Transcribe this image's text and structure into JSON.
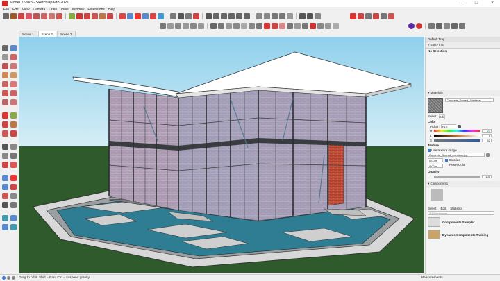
{
  "window": {
    "title": "Model 26.skp - SketchUp Pro 2021"
  },
  "menu": [
    "File",
    "Edit",
    "View",
    "Camera",
    "Draw",
    "Tools",
    "Window",
    "Extensions",
    "Help"
  ],
  "scenes": [
    "Scene 1",
    "Scene 2",
    "Scene 3"
  ],
  "tray": {
    "title": "Default Tray",
    "entity_info": {
      "header": "Entity Info",
      "value": "No Selection"
    },
    "materials": {
      "header": "Materials",
      "name": "Concrete_Scored_Jointless",
      "tabs": [
        "Select",
        "Edit"
      ],
      "color_label": "Color",
      "picker_label": "Picker:",
      "picker_value": "HLS",
      "sliders": [
        {
          "label": "H",
          "value": "27"
        },
        {
          "label": "L",
          "value": "5"
        },
        {
          "label": "S",
          "value": "52"
        }
      ],
      "texture_label": "Texture",
      "use_texture_label": "Use texture image",
      "texture_file": "Concrete_Scored_Jointless.jpg",
      "width": "0,00 m",
      "height": "0,00 m",
      "colorize_label": "Colorize",
      "reset_label": "Reset Color",
      "opacity_label": "Opacity",
      "opacity_value": "100"
    },
    "components": {
      "header": "Components",
      "tabs": [
        "Select",
        "Edit",
        "Statistics"
      ],
      "search_placeholder": "3D Warehouse",
      "items": [
        {
          "name": "Components Sampler"
        },
        {
          "name": "Dynamic Components Training"
        }
      ]
    }
  },
  "status": {
    "message": "Drag to orbit. Shift = Pan, Ctrl = suspend gravity.",
    "measurements_label": "Measurements"
  },
  "colors": {
    "sky": "#a9dcf0",
    "grass": "#2f5a2b",
    "brick": "#c88a9a",
    "glass": "#7fa6c8",
    "water": "#2f7d93",
    "accent_red": "#d92a2a",
    "accent_blue": "#3a78d6"
  }
}
